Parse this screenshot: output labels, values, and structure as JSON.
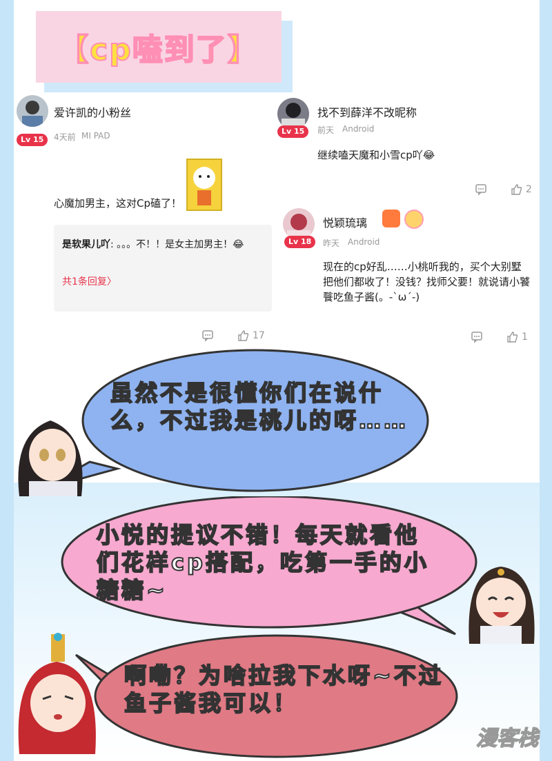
{
  "tag": {
    "label": "【cp嗑到了】"
  },
  "comments": [
    {
      "username": "爱许凯的小粉丝",
      "level": "Lv 15",
      "time": "4天前",
      "device": "MI PAD",
      "text": "心魔加男主，这对Cp磕了！",
      "reply": {
        "user": "是软果儿吖",
        "text": "。。。不！！是女主加男主！😂",
        "more": "共1条回复〉"
      },
      "reply_count_icon": "comment-icon",
      "likes": "17"
    },
    {
      "username": "找不到薛洋不改昵称",
      "level": "Lv 15",
      "time": "前天",
      "device": "Android",
      "text": "继续嗑天魔和小雪cp吖😂",
      "likes": "2"
    },
    {
      "username": "悦颖琉璃",
      "level": "Lv 18",
      "time": "昨天",
      "device": "Android",
      "text": "现在的cp好乱……小桃听我的，买个大别墅把他们都收了！没钱？找师父要！就说请小饕餮吃鱼子酱(。-`ω´-)",
      "likes": "1"
    }
  ],
  "bubbles": [
    {
      "text": "虽然不是很懂你们在说什么，不过我是桃儿的呀……",
      "color": "#8fb3f0"
    },
    {
      "text": "小悦的提议不错！每天就看他们花样cp搭配，吃第一手的小糖糖~",
      "color": "#f7a9cf"
    },
    {
      "text": "啊嘞？为啥拉我下水呀~不过鱼子酱我可以！",
      "color": "#e07a85"
    }
  ],
  "watermark": "漫客栈",
  "colors": {
    "accent": "#e8334a",
    "tag_bg": "#f9d5e3",
    "tag_text": "#ffe040"
  }
}
